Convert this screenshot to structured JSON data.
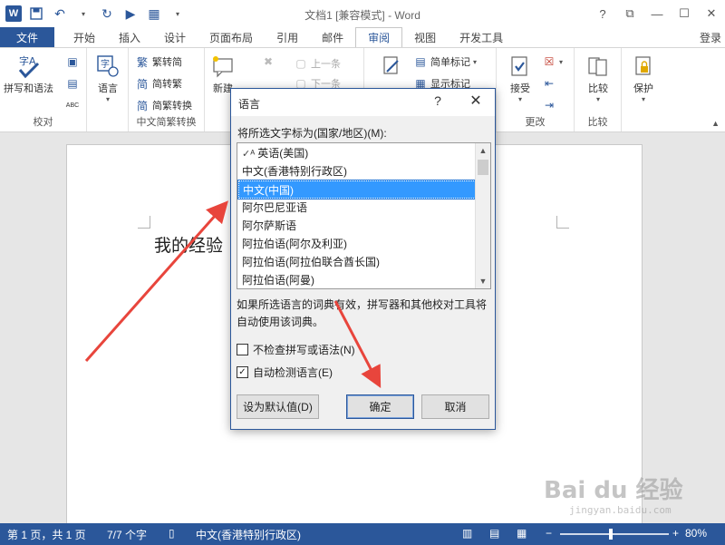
{
  "window": {
    "title": "文档1 [兼容模式] - Word",
    "login": "登录"
  },
  "tabs": {
    "file": "文件",
    "items": [
      "开始",
      "插入",
      "设计",
      "页面布局",
      "引用",
      "邮件",
      "审阅",
      "视图",
      "开发工具"
    ],
    "active": "审阅"
  },
  "ribbon": {
    "proofing": {
      "spelling": "拼写和语法",
      "label": "校对"
    },
    "language": {
      "button": "语言"
    },
    "chinese_conversion": {
      "to_traditional": "繁转简",
      "to_simplified": "简转繁",
      "convert": "简繁转换",
      "label": "中文简繁转换"
    },
    "comments": {
      "new": "新建",
      "previous": "上一条",
      "next": "下一条"
    },
    "tracking": {
      "simple_markup": "简单标记",
      "show_markup": "显示标记"
    },
    "changes": {
      "accept": "接受",
      "label": "更改"
    },
    "compare": {
      "button": "比较",
      "label": "比较"
    },
    "protect": {
      "button": "保护"
    }
  },
  "document": {
    "text": "我的经验"
  },
  "dialog": {
    "title": "语言",
    "help": "?",
    "close": "✕",
    "list_label": "将所选文字标为(国家/地区)(M):",
    "languages": [
      "英语(美国)",
      "中文(香港特别行政区)",
      "中文(中国)",
      "阿尔巴尼亚语",
      "阿尔萨斯语",
      "阿拉伯语(阿尔及利亚)",
      "阿拉伯语(阿拉伯联合酋长国)",
      "阿拉伯语(阿曼)"
    ],
    "selected_index": 2,
    "note": "如果所选语言的词典有效，拼写器和其他校对工具将自动使用该词典。",
    "no_proof": "不检查拼写或语法(N)",
    "no_proof_checked": false,
    "auto_detect": "自动检测语言(E)",
    "auto_detect_checked": true,
    "set_default": "设为默认值(D)",
    "ok": "确定",
    "cancel": "取消"
  },
  "status": {
    "page": "第 1 页，共 1 页",
    "words": "7/7 个字",
    "language": "中文(香港特别行政区)",
    "zoom": "80%"
  },
  "watermark": {
    "brand": "Bai du 经验",
    "url": "jingyan.baidu.com"
  },
  "colors": {
    "accent": "#2b579a",
    "selection": "#3399ff",
    "arrow": "#e8453c"
  }
}
